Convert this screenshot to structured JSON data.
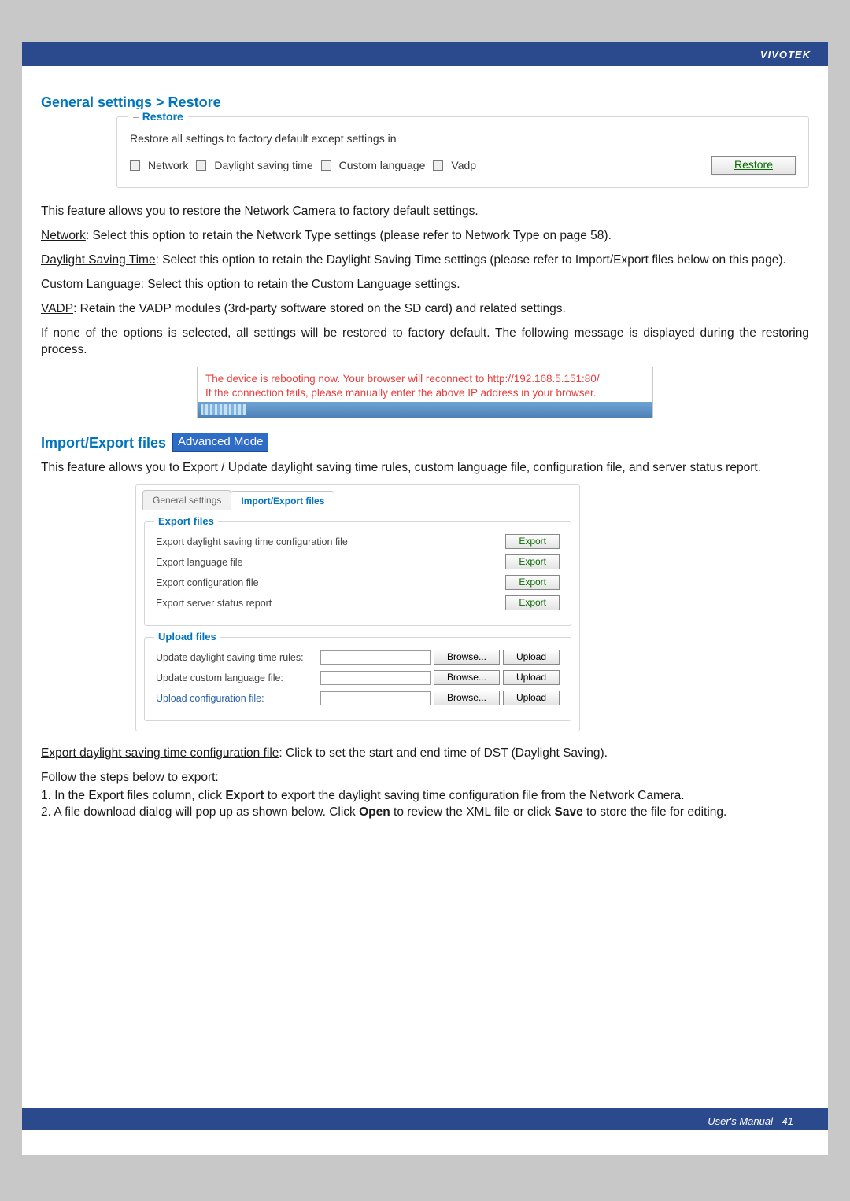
{
  "brand": "VIVOTEK",
  "section_restore_title": "General settings > Restore",
  "restore": {
    "legend": "Restore",
    "desc": "Restore all settings to factory default except settings in",
    "cb_network": "Network",
    "cb_dst": "Daylight saving time",
    "cb_lang": "Custom language",
    "cb_vadp": "Vadp",
    "button": "Restore"
  },
  "p_intro": "This feature allows you to restore the Network Camera to factory default settings.",
  "network_u": "Network",
  "network_body": ": Select this option to retain the Network Type settings (please refer to Network Type on page 58).",
  "dst_u": "Daylight Saving Time",
  "dst_body": ": Select this option to retain the Daylight Saving Time settings (please refer to Import/Export files below on this page).",
  "lang_u": "Custom Language",
  "lang_body": ": Select this option to retain the Custom Language settings.",
  "vadp_u": "VADP",
  "vadp_body": ": Retain the VADP modules (3rd-party software stored on the SD card) and related settings.",
  "none_body": "If none of the options is selected, all settings will be restored to factory default. The following message is displayed during the restoring process.",
  "reboot_line1": "The device is rebooting now. Your browser will reconnect to http://192.168.5.151:80/",
  "reboot_line2": "If the connection fails, please manually enter the above IP address in your browser.",
  "importexport_title": "Import/Export files",
  "advanced": "Advanced Mode",
  "ie_desc": "This feature allows you to Export / Update daylight saving time rules, custom language file, configuration file, and server status report.",
  "tabs": {
    "general": "General settings",
    "ie": "Import/Export files"
  },
  "exportfiles": {
    "legend": "Export files",
    "r1": "Export daylight saving time configuration file",
    "r2": "Export language file",
    "r3": "Export configuration file",
    "r4": "Export server status report",
    "btn": "Export"
  },
  "uploadfiles": {
    "legend": "Upload files",
    "r1": "Update daylight saving time rules:",
    "r2": "Update custom language file:",
    "r3": "Upload configuration file:",
    "browse": "Browse...",
    "upload": "Upload"
  },
  "export_dst_u": "Export daylight saving time configuration file",
  "export_dst_body": ": Click to set the start and end time of DST (Daylight Saving).",
  "steps_intro": "Follow the steps below to export:",
  "step1_a": "1. In the Export files column, click ",
  "step1_bold": "Export",
  "step1_b": " to export the daylight saving time configuration file from the Network Camera.",
  "step2_a": "2. A file download dialog will pop up as shown below. Click ",
  "step2_bold1": "Open",
  "step2_mid": " to review the XML file or click ",
  "step2_bold2": "Save",
  "step2_b": " to store the file for editing.",
  "footer_page": "User's Manual - 41"
}
